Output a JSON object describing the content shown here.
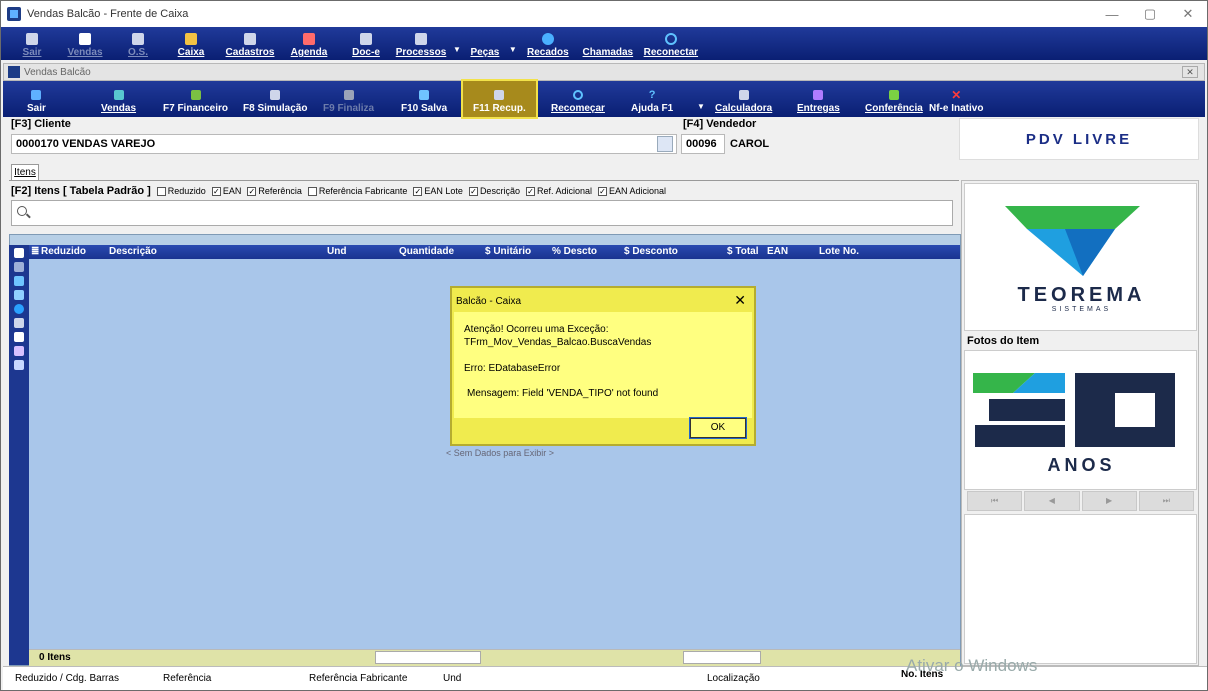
{
  "window": {
    "title": "Vendas Balcão - Frente de Caixa",
    "min": "—",
    "max": "▢",
    "close": "✕"
  },
  "main_toolbar": [
    {
      "label": "Sair",
      "color": "#cfd6ea",
      "dim": true
    },
    {
      "label": "Vendas",
      "color": "#ffffff",
      "dim": true
    },
    {
      "label": "O.S.",
      "color": "#cfd6ea",
      "dim": true
    },
    {
      "label": "Caixa",
      "color": "#f3c244",
      "dim": false
    },
    {
      "label": "Cadastros",
      "color": "#cfd6ea",
      "dim": false
    },
    {
      "label": "Agenda",
      "color": "#ff6b6b",
      "dim": false
    },
    {
      "label": "Doc-e",
      "color": "#cfd6ea",
      "dim": false
    },
    {
      "label": "Processos",
      "color": "#cfd6ea",
      "dim": false
    },
    {
      "label": "Peças",
      "color": "#5aa0ff",
      "dim": false
    },
    {
      "label": "Recados",
      "color": "#4ab0ff",
      "dim": false
    },
    {
      "label": "Chamadas",
      "color": "#8fa8d8",
      "dim": false
    },
    {
      "label": "Reconectar",
      "color": "#5fc2ff",
      "dim": false
    }
  ],
  "mdi": {
    "title": "Vendas Balcão",
    "close": "✕"
  },
  "sub_toolbar": [
    {
      "label": "Sair",
      "color": "#5fb0ff"
    },
    {
      "label": "Vendas",
      "color": "#58c8d0"
    },
    {
      "label": "F7 Financeiro",
      "color": "#7bc043"
    },
    {
      "label": "F8 Simulação",
      "color": "#cfd6ea"
    },
    {
      "label": "F9 Finaliza",
      "color": "#9aa3b8"
    },
    {
      "label": "F10 Salva",
      "color": "#6fc4ff"
    },
    {
      "label": "F11 Recup.",
      "color": "#cfd6ea"
    },
    {
      "label": "Recomeçar",
      "color": "#5fc2ff"
    },
    {
      "label": "Ajuda F1",
      "color": "#5fc2ff"
    },
    {
      "label": "Calculadora",
      "color": "#cfd6ea"
    },
    {
      "label": "Entregas",
      "color": "#b07cff"
    },
    {
      "label": "Conferência",
      "color": "#7bd043"
    },
    {
      "label": "Nf-e Inativo",
      "color": "#ff3b3b"
    }
  ],
  "cliente": {
    "label": "[F3] Cliente",
    "value": "0000170  VENDAS VAREJO"
  },
  "vendedor": {
    "label": "[F4] Vendedor",
    "code": "00096",
    "name": "CAROL"
  },
  "pdv": "PDV LIVRE",
  "tab": "Itens",
  "items_header": "[F2] Itens [ Tabela Padrão ]",
  "checkboxes": [
    {
      "label": "Reduzido",
      "checked": false
    },
    {
      "label": "EAN",
      "checked": true
    },
    {
      "label": "Referência",
      "checked": true
    },
    {
      "label": "Referência Fabricante",
      "checked": false
    },
    {
      "label": "EAN Lote",
      "checked": true
    },
    {
      "label": "Descrição",
      "checked": true
    },
    {
      "label": "Ref. Adicional",
      "checked": true
    },
    {
      "label": "EAN Adicional",
      "checked": true
    }
  ],
  "grid": {
    "columns": [
      "Reduzido",
      "Descrição",
      "Und",
      "Quantidade",
      "$ Unitário",
      "% Descto",
      "$ Desconto",
      "$ Total",
      "EAN",
      "Lote No."
    ],
    "empty": "< Sem Dados para Exibir >",
    "count": "0 Itens"
  },
  "bottom": [
    "Reduzido / Cdg. Barras",
    "Referência",
    "Referência Fabricante",
    "Und",
    "Localização",
    "No. Itens"
  ],
  "brand": {
    "name": "TEOREMA",
    "sub": "SISTEMAS",
    "anos": "ANOS"
  },
  "fotos_label": "Fotos do Item",
  "nav": [
    "⏮",
    "◀",
    "▶",
    "⏭"
  ],
  "watermark": "Ativar o Windows",
  "dialog": {
    "title": "Balcão - Caixa",
    "line1": "Atenção! Ocorreu uma Exceção:",
    "line2": "TFrm_Mov_Vendas_Balcao.BuscaVendas",
    "line3": "Erro: EDatabaseError",
    "line4": "Mensagem: Field 'VENDA_TIPO' not found",
    "ok": "OK"
  }
}
